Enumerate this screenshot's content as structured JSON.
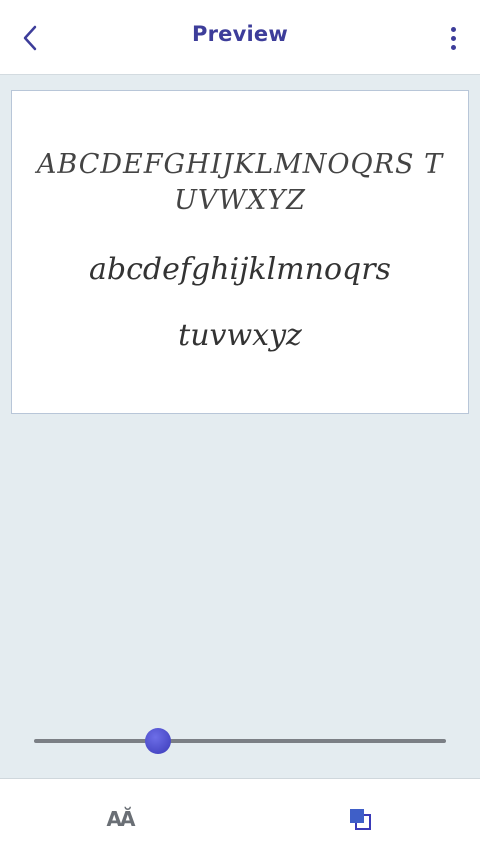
{
  "header": {
    "title": "Preview",
    "back_icon": "chevron-left-icon",
    "menu_icon": "more-vertical-icon"
  },
  "preview": {
    "uppercase_sample": "ABCDEFGHIJKLMNOQRS TUVWXYZ",
    "lowercase_line1": "abcdefghijklmnoqrs",
    "lowercase_line2": "tuvwxyz"
  },
  "size_slider": {
    "value": 0.3
  },
  "bottom_bar": {
    "font_icon_label": "AĂ",
    "font_icon": "font-style-icon",
    "copy_icon": "layers-copy-icon"
  },
  "colors": {
    "accent": "#3d3d9a",
    "background": "#e4ecf0",
    "slider_track": "#7b7f85",
    "slider_thumb": "#4646c4"
  }
}
